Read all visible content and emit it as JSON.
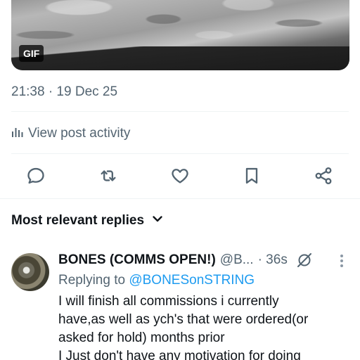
{
  "media": {
    "badge": "GIF"
  },
  "post": {
    "timestamp": "21:38 · 19 Dec 25",
    "activity_label": "View post activity"
  },
  "actions": [
    "reply-icon",
    "repost-icon",
    "like-icon",
    "bookmark-icon",
    "share-icon"
  ],
  "replies_section": {
    "sort_label": "Most relevant replies"
  },
  "reply": {
    "display_name": "BONES (COMMS OPEN!)",
    "handle": "@B...",
    "time": "· 36s",
    "replying_prefix": "Replying to",
    "replying_to": "@BONESonSTRING",
    "lines": [
      "I will finish all commissions i currently",
      "have,as well as ych's that were ordered(or",
      "asked for hold) months prior",
      "I Just don't have any motivation for doing"
    ]
  },
  "colors": {
    "text": "#0f1419",
    "muted": "#536471",
    "link": "#1d9bf0",
    "divider": "#eff3f4"
  }
}
